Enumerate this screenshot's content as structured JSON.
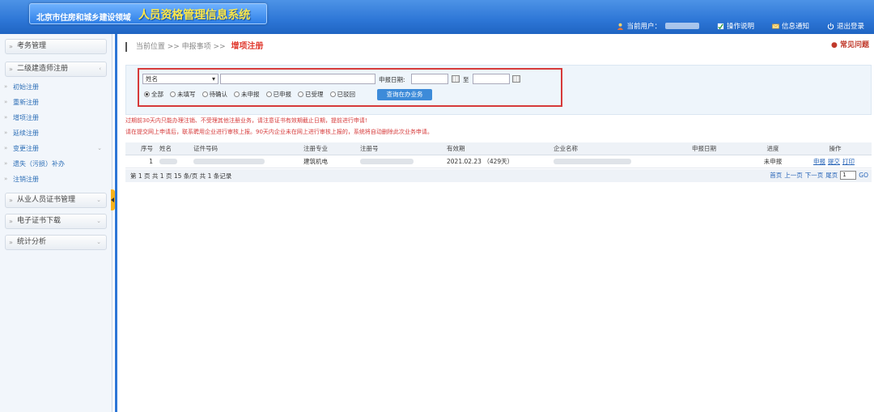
{
  "header": {
    "org": "北京市住房和城乡建设领域",
    "system": "人员资格管理信息系统",
    "current_user_label": "当前用户：",
    "help": "操作说明",
    "notice": "信息通知",
    "logout": "退出登录"
  },
  "sidebar": {
    "menu1": "考务管理",
    "menu2": "二级建造师注册",
    "subs": [
      "初始注册",
      "重新注册",
      "增项注册",
      "延续注册",
      "变更注册",
      "遗失（污损）补办",
      "注销注册"
    ],
    "menu3": "从业人员证书管理",
    "menu4": "电子证书下载",
    "menu5": "统计分析"
  },
  "breadcrumb": {
    "path": "当前位置 >> 申报事项 >>",
    "current": "增项注册",
    "faq": "常见问题"
  },
  "search": {
    "field_select": "姓名",
    "date_label": "申报日期:",
    "to_label": "至",
    "radios": [
      "全部",
      "未填写",
      "待确认",
      "未申报",
      "已申报",
      "已受理",
      "已驳回"
    ],
    "query_button": "查询在办业务"
  },
  "notices": [
    "过期前30天内只能办理注销、不受理其他注册业务，请注意证书有效期截止日期，提前进行申请!",
    "请在提交网上申请后，联系聘用企业进行审核上报。90天内企业未在网上进行审核上报的，系统将自动删除此次业务申请。"
  ],
  "table": {
    "headers": [
      "序号",
      "姓名",
      "证件号码",
      "注册专业",
      "注册号",
      "有效期",
      "企业名称",
      "申报日期",
      "进度",
      "操作"
    ],
    "row": {
      "index": "1",
      "major": "建筑机电",
      "validity": "2021.02.23 （429天）",
      "progress": "未申报",
      "ops": [
        "申报",
        "提交",
        "打印"
      ]
    }
  },
  "pager": {
    "summary": "第 1 页  共 1 页  15 条/页  共 1 条记录",
    "first": "首页",
    "prev": "上一页",
    "next": "下一页",
    "last": "尾页",
    "page_input": "1",
    "go": "GO"
  }
}
